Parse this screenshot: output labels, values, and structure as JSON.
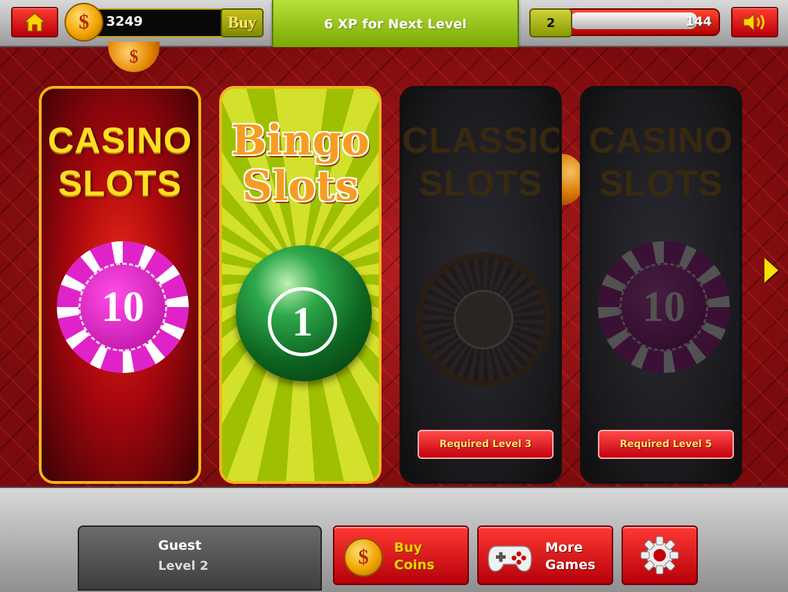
{
  "top_bar": {
    "coins": "3249",
    "buy_label": "Buy",
    "xp_message": "6 XP for Next Level",
    "level": "2",
    "xp_value": "144",
    "xp_progress": 0.88
  },
  "games": [
    {
      "title_line1": "CASINO",
      "title_line2": "SLOTS",
      "chip_value": "10",
      "locked": false
    },
    {
      "title_line1": "Bingo",
      "title_line2": "Slots",
      "ball_number": "1",
      "locked": false
    },
    {
      "title_line1": "CLASSIC",
      "title_line2": "SLOTS",
      "locked": true,
      "requirement": "Required Level 3"
    },
    {
      "title_line1": "CASINO",
      "title_line2": "SLOTS",
      "chip_value": "10",
      "locked": true,
      "requirement": "Required Level 5"
    }
  ],
  "profile": {
    "name": "Guest",
    "level": "Level 2"
  },
  "bottom": {
    "buy_coins_line1": "Buy",
    "buy_coins_line2": "Coins",
    "more_games_line1": "More",
    "more_games_line2": "Games"
  },
  "icons": {
    "home": "home-icon",
    "sound": "speaker-icon",
    "coin": "dollar-coin-icon",
    "next": "right-arrow-icon",
    "games": "gamepad-icon",
    "settings": "gear-icon"
  },
  "colors": {
    "accent_red": "#d40010",
    "accent_green": "#8cc400",
    "gold": "#f1b41c",
    "coin_yellow": "#f1a400"
  }
}
